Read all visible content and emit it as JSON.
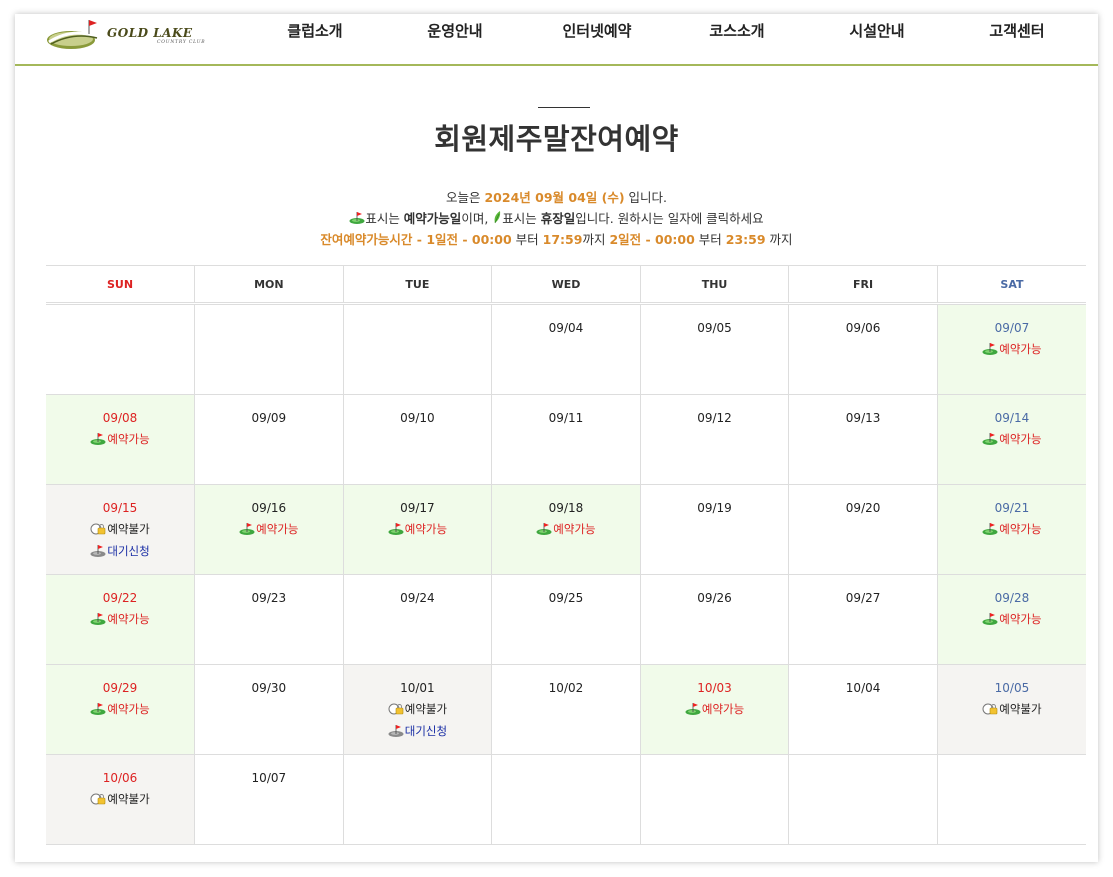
{
  "logo": {
    "name": "GOLD LAKE",
    "sub": "COUNTRY CLUB"
  },
  "nav": [
    "클럽소개",
    "운영안내",
    "인터넷예약",
    "코스소개",
    "시설안내",
    "고객센터"
  ],
  "title": "회원제주말잔여예약",
  "info": {
    "today_prefix": "오늘은 ",
    "today_date": "2024년 09월 04일 (수)",
    "today_suffix": " 입니다.",
    "legend_part1": "표시는 ",
    "legend_avail": "예약가능일",
    "legend_part2": "이며,",
    "legend_part3": "표시는 ",
    "legend_closed": "휴장일",
    "legend_part4": "입니다. 원하시는 일자에 클릭하세요",
    "rule_label": "잔여예약가능시간 - 1일전 - 00:00",
    "rule_t1": " 부터 ",
    "rule_t2": "17:59",
    "rule_t3": "까지 ",
    "rule_t4": "2일전 - 00:00",
    "rule_t5": " 부터 ",
    "rule_t6": "23:59",
    "rule_t7": " 까지"
  },
  "weekdays": [
    "SUN",
    "MON",
    "TUE",
    "WED",
    "THU",
    "FRI",
    "SAT"
  ],
  "status_labels": {
    "ok": "예약가능",
    "no": "예약불가",
    "wait": "대기신청"
  },
  "weeks": [
    [
      null,
      null,
      null,
      {
        "date": "09/04",
        "status": []
      },
      {
        "date": "09/05",
        "status": []
      },
      {
        "date": "09/06",
        "status": []
      },
      {
        "date": "09/07",
        "status": [
          "ok"
        ]
      }
    ],
    [
      {
        "date": "09/08",
        "status": [
          "ok"
        ]
      },
      {
        "date": "09/09",
        "status": []
      },
      {
        "date": "09/10",
        "status": []
      },
      {
        "date": "09/11",
        "status": []
      },
      {
        "date": "09/12",
        "status": []
      },
      {
        "date": "09/13",
        "status": []
      },
      {
        "date": "09/14",
        "status": [
          "ok"
        ]
      }
    ],
    [
      {
        "date": "09/15",
        "status": [
          "no",
          "wait"
        ]
      },
      {
        "date": "09/16",
        "status": [
          "ok"
        ]
      },
      {
        "date": "09/17",
        "status": [
          "ok"
        ]
      },
      {
        "date": "09/18",
        "status": [
          "ok"
        ]
      },
      {
        "date": "09/19",
        "status": []
      },
      {
        "date": "09/20",
        "status": []
      },
      {
        "date": "09/21",
        "status": [
          "ok"
        ]
      }
    ],
    [
      {
        "date": "09/22",
        "status": [
          "ok"
        ]
      },
      {
        "date": "09/23",
        "status": []
      },
      {
        "date": "09/24",
        "status": []
      },
      {
        "date": "09/25",
        "status": []
      },
      {
        "date": "09/26",
        "status": []
      },
      {
        "date": "09/27",
        "status": []
      },
      {
        "date": "09/28",
        "status": [
          "ok"
        ]
      }
    ],
    [
      {
        "date": "09/29",
        "status": [
          "ok"
        ]
      },
      {
        "date": "09/30",
        "status": []
      },
      {
        "date": "10/01",
        "status": [
          "no",
          "wait"
        ]
      },
      {
        "date": "10/02",
        "status": []
      },
      {
        "date": "10/03",
        "status": [
          "ok"
        ],
        "holiday": true
      },
      {
        "date": "10/04",
        "status": []
      },
      {
        "date": "10/05",
        "status": [
          "no"
        ]
      }
    ],
    [
      {
        "date": "10/06",
        "status": [
          "no"
        ]
      },
      {
        "date": "10/07",
        "status": []
      },
      null,
      null,
      null,
      null,
      null
    ]
  ],
  "colors": {
    "accent_line": "#a4b85a",
    "available_bg": "#f1fbea",
    "closed_bg": "#f5f4f2",
    "sunday": "#dd2222",
    "saturday": "#4a6aa5",
    "highlight": "#d98a2b",
    "waitlist": "#1a2ea5"
  }
}
